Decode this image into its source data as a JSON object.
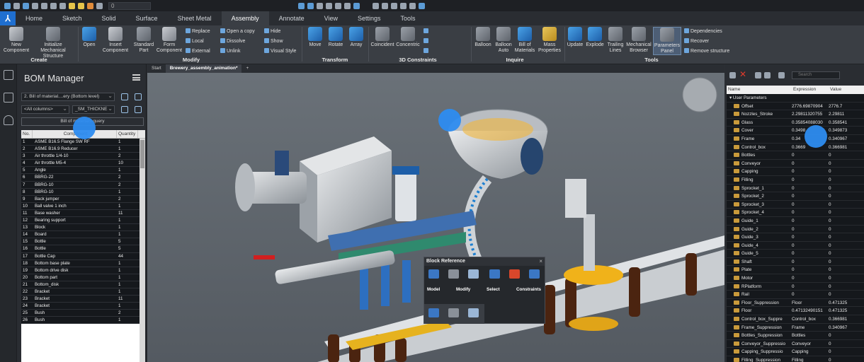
{
  "quick_access": {
    "layer_value": "0"
  },
  "ribbon_tabs": [
    "Home",
    "Sketch",
    "Solid",
    "Surface",
    "Sheet Metal",
    "Assembly",
    "Annotate",
    "View",
    "Settings",
    "Tools"
  ],
  "active_tab": "Assembly",
  "ribbon": {
    "create": {
      "group": "Create",
      "new_component": "New Component",
      "initialize": "Initialize Mechanical Structure"
    },
    "modify": {
      "group": "Modify",
      "open": "Open",
      "insert": "Insert Component",
      "standard": "Standard Part",
      "form": "Form Component",
      "replace": "Replace",
      "local": "Local",
      "external": "External",
      "open_copy": "Open a copy",
      "dissolve": "Dissolve",
      "unlink": "Unlink",
      "hide": "Hide",
      "show": "Show",
      "visual_style": "Visual Style"
    },
    "transform": {
      "group": "Transform",
      "move": "Move",
      "rotate": "Rotate",
      "array": "Array"
    },
    "constraints": {
      "group": "3D Constraints",
      "coincident": "Coincident",
      "concentric": "Concentric"
    },
    "inquire": {
      "group": "Inquire",
      "balloon": "Balloon",
      "balloon_auto": "Balloon Auto",
      "bom": "Bill of Materials",
      "mass": "Mass Properties"
    },
    "tools": {
      "group": "Tools",
      "update": "Update",
      "explode": "Explode",
      "trailing": "Trailing Lines",
      "mech_browser": "Mechanical Browser",
      "param_panel": "Parameters Panel",
      "dependencies": "Dependencies",
      "recover": "Recover",
      "remove_structure": "Remove structure"
    }
  },
  "bom": {
    "title": "BOM Manager",
    "level_select": "2. Bill of material....ery (Bottom level)",
    "columns_select": "<All columns>",
    "filter_select": "_SM_THICKNE",
    "query_button": "Bill of materials query",
    "headers": {
      "no": "No.",
      "component": "Component",
      "quantity": "Quantity"
    },
    "rows": [
      {
        "no": "1",
        "name": "ASME B16.5 Flange SW RF",
        "qty": "1"
      },
      {
        "no": "2",
        "name": "ASME B16.9 Reducer",
        "qty": "1"
      },
      {
        "no": "3",
        "name": "Air throttle 1/4-10",
        "qty": "2"
      },
      {
        "no": "4",
        "name": "Air throttle M5-4",
        "qty": "10"
      },
      {
        "no": "5",
        "name": "Angle",
        "qty": "1"
      },
      {
        "no": "6",
        "name": "BBRG-22",
        "qty": "2"
      },
      {
        "no": "7",
        "name": "BBRG-10",
        "qty": "2"
      },
      {
        "no": "8",
        "name": "BBRG-10",
        "qty": "1"
      },
      {
        "no": "9",
        "name": "Back jumper",
        "qty": "2"
      },
      {
        "no": "10",
        "name": "Ball valve 1 inch",
        "qty": "1"
      },
      {
        "no": "11",
        "name": "Base washer",
        "qty": "11"
      },
      {
        "no": "12",
        "name": "Bearing support",
        "qty": "1"
      },
      {
        "no": "13",
        "name": "Block",
        "qty": "1"
      },
      {
        "no": "14",
        "name": "Board",
        "qty": "1"
      },
      {
        "no": "15",
        "name": "Bottle",
        "qty": "5"
      },
      {
        "no": "16",
        "name": "Bottle",
        "qty": "5"
      },
      {
        "no": "17",
        "name": "Bottle Cap",
        "qty": "44"
      },
      {
        "no": "18",
        "name": "Bottom base plate",
        "qty": "1"
      },
      {
        "no": "19",
        "name": "Bottom drive disk",
        "qty": "1"
      },
      {
        "no": "20",
        "name": "Bottom part",
        "qty": "1"
      },
      {
        "no": "21",
        "name": "Bottom_disk",
        "qty": "1"
      },
      {
        "no": "22",
        "name": "Bracket",
        "qty": "1"
      },
      {
        "no": "23",
        "name": "Bracket",
        "qty": "11"
      },
      {
        "no": "24",
        "name": "Bracket",
        "qty": "1"
      },
      {
        "no": "25",
        "name": "Bush",
        "qty": "2"
      },
      {
        "no": "26",
        "name": "Bush",
        "qty": "1"
      }
    ]
  },
  "viewport": {
    "tabs": [
      "Start",
      "Brewery_assembly_animation*",
      "+"
    ]
  },
  "block_reference": {
    "title": "Block Reference",
    "labels": [
      "Model",
      "Modify",
      "Select",
      "Constraints"
    ]
  },
  "params": {
    "search_placeholder": "Search",
    "headers": {
      "name": "Name",
      "expression": "Expression",
      "value": "Value"
    },
    "group": "User Parameters",
    "rows": [
      {
        "name": "Offset",
        "expr": "2776.69870904",
        "val": "2776.7"
      },
      {
        "name": "Nozzles_Stroke",
        "expr": "2.29811320755",
        "val": "2.29811"
      },
      {
        "name": "Glass",
        "expr": "0.35854088030",
        "val": "0.358541"
      },
      {
        "name": "Cover",
        "expr": "0.3498",
        "val": "0.349873"
      },
      {
        "name": "Frame",
        "expr": "0.34",
        "val": "0.340967"
      },
      {
        "name": "Control_box",
        "expr": "0.3669",
        "val": "0.366981"
      },
      {
        "name": "Bottles",
        "expr": "0",
        "val": "0"
      },
      {
        "name": "Conveyor",
        "expr": "0",
        "val": "0"
      },
      {
        "name": "Capping",
        "expr": "0",
        "val": "0"
      },
      {
        "name": "Filling",
        "expr": "0",
        "val": "0"
      },
      {
        "name": "Sprocket_1",
        "expr": "0",
        "val": "0"
      },
      {
        "name": "Sprocket_2",
        "expr": "0",
        "val": "0"
      },
      {
        "name": "Sprocket_3",
        "expr": "0",
        "val": "0"
      },
      {
        "name": "Sprocket_4",
        "expr": "0",
        "val": "0"
      },
      {
        "name": "Guide_1",
        "expr": "0",
        "val": "0"
      },
      {
        "name": "Guide_2",
        "expr": "0",
        "val": "0"
      },
      {
        "name": "Guide_3",
        "expr": "0",
        "val": "0"
      },
      {
        "name": "Guide_4",
        "expr": "0",
        "val": "0"
      },
      {
        "name": "Guide_5",
        "expr": "0",
        "val": "0"
      },
      {
        "name": "Shaft",
        "expr": "0",
        "val": "0"
      },
      {
        "name": "Plate",
        "expr": "0",
        "val": "0"
      },
      {
        "name": "Motor",
        "expr": "0",
        "val": "0"
      },
      {
        "name": "RPlatform",
        "expr": "0",
        "val": "0"
      },
      {
        "name": "Rail",
        "expr": "0",
        "val": "0"
      },
      {
        "name": "Floor_Suppression",
        "expr": "Floor",
        "val": "0.471325"
      },
      {
        "name": "Floor",
        "expr": "0.47132490151",
        "val": "0.471325"
      },
      {
        "name": "Control_box_Suppre",
        "expr": "Control_box",
        "val": "0.366981"
      },
      {
        "name": "Frame_Suppression",
        "expr": "Frame",
        "val": "0.340967"
      },
      {
        "name": "Bottles_Suppression",
        "expr": "Bottles",
        "val": "0"
      },
      {
        "name": "Conveyor_Suppressio",
        "expr": "Conveyor",
        "val": "0"
      },
      {
        "name": "Capping_Suppressio",
        "expr": "Capping",
        "val": "0"
      },
      {
        "name": "Filling_Suppression",
        "expr": "Filling",
        "val": "0"
      }
    ]
  }
}
